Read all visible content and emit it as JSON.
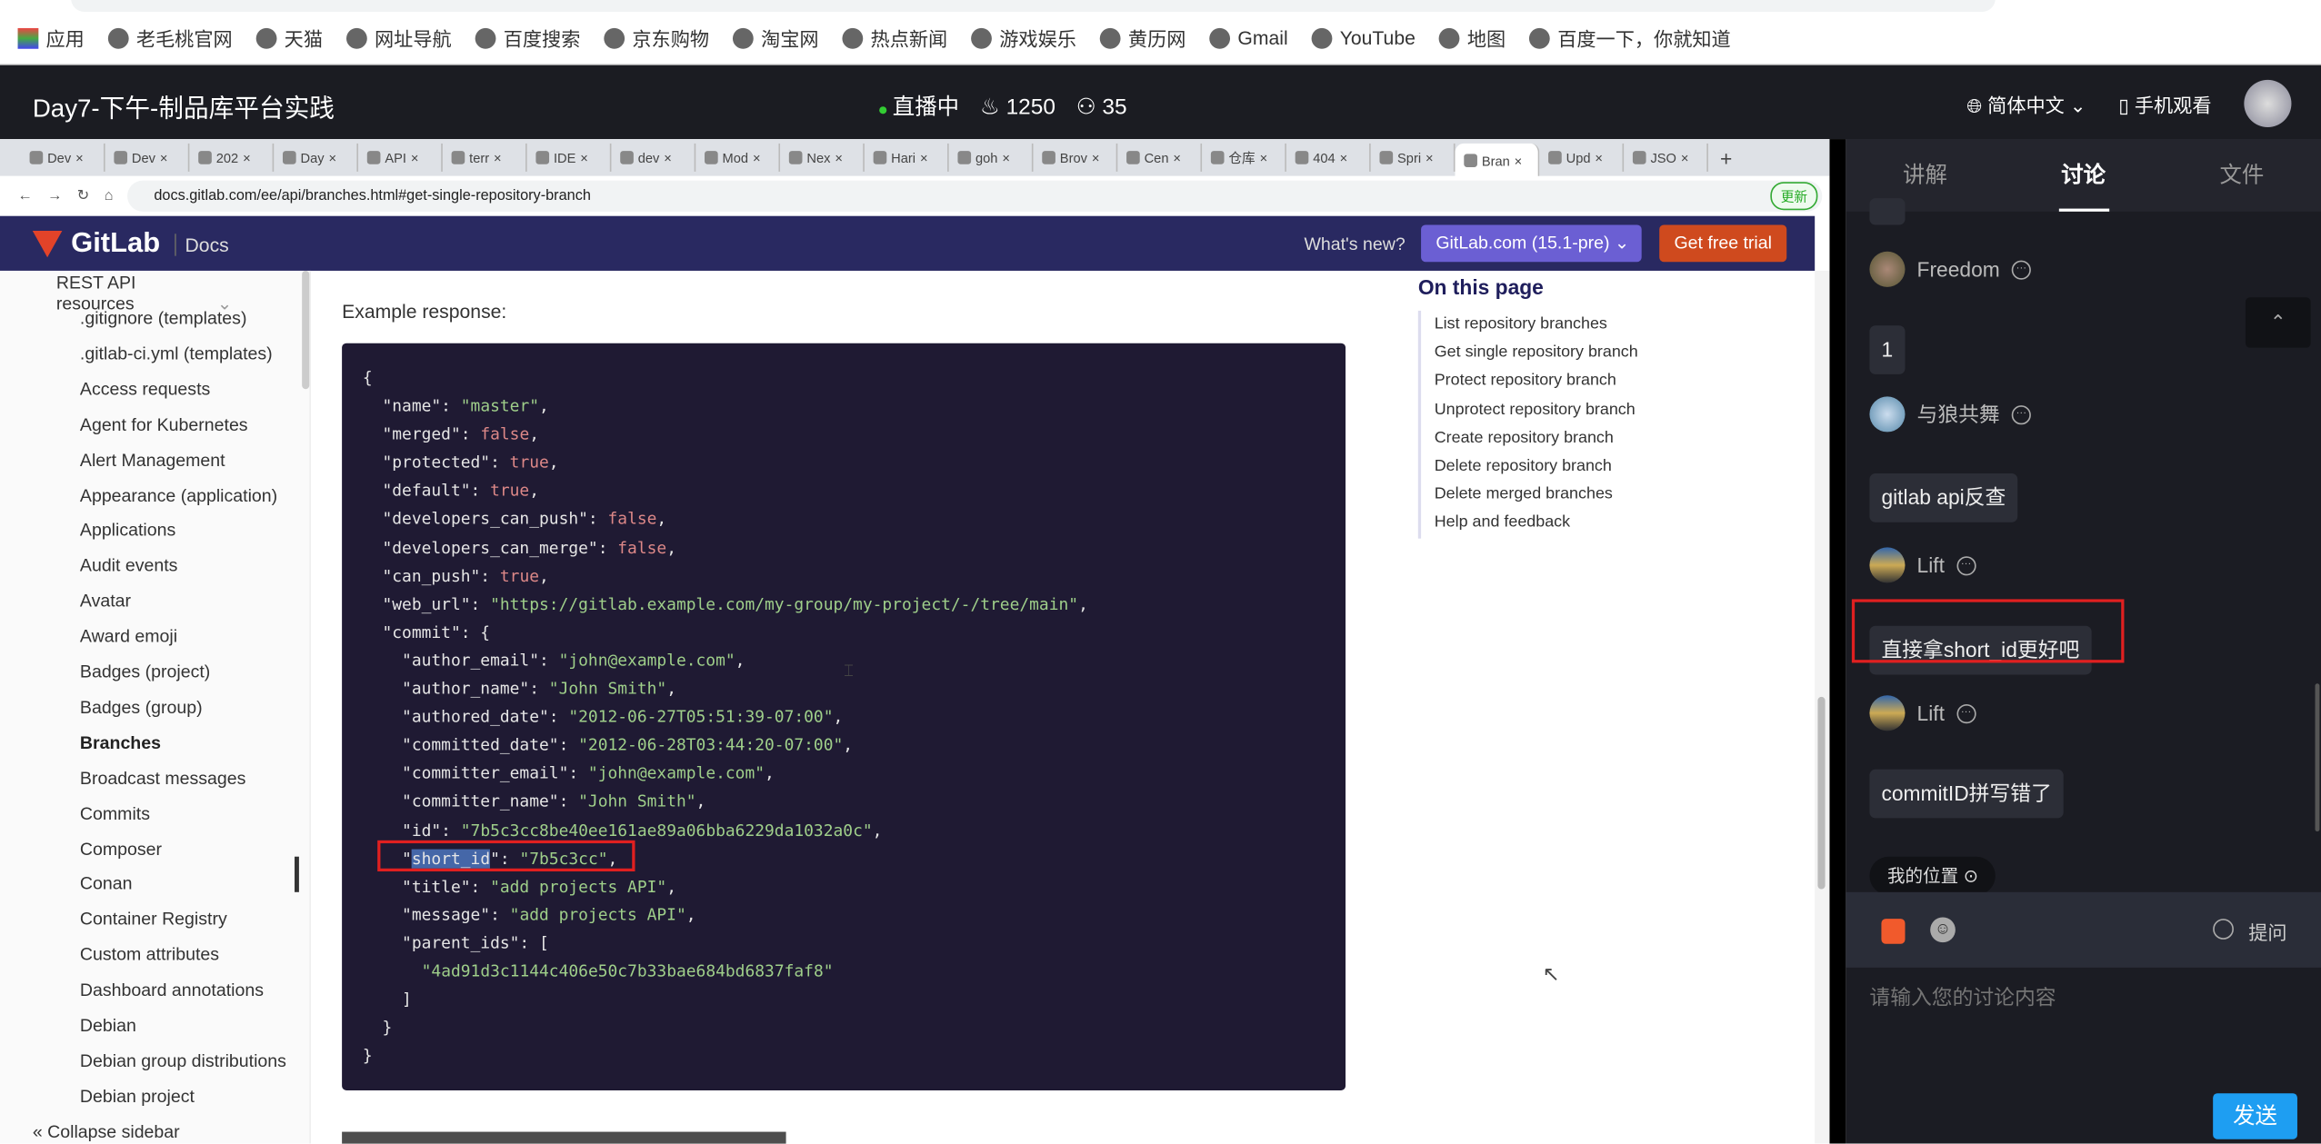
{
  "bookmarks": [
    "应用",
    "老毛桃官网",
    "天猫",
    "网址导航",
    "百度搜索",
    "京东购物",
    "淘宝网",
    "热点新闻",
    "游戏娱乐",
    "黄历网",
    "Gmail",
    "YouTube",
    "地图",
    "百度一下，你就知道"
  ],
  "live": {
    "title": "Day7-下午-制品库平台实践",
    "status": "直播中",
    "hot": "1250",
    "viewers": "35",
    "language": "简体中文",
    "mobile": "手机观看"
  },
  "browser": {
    "tabs": [
      "Dev",
      "Dev",
      "202",
      "Day",
      "API",
      "terr",
      "IDE",
      "dev",
      "Mod",
      "Nex",
      "Hari",
      "goh",
      "Brov",
      "Cen",
      "仓库",
      "404",
      "Spri",
      "Bran",
      "Upd",
      "JSO"
    ],
    "active_tab": 17,
    "url": "docs.gitlab.com/ee/api/branches.html#get-single-repository-branch",
    "update": "更新"
  },
  "gitlab": {
    "logo": "GitLab",
    "docs": "Docs",
    "whats_new": "What's new?",
    "version": "GitLab.com (15.1-pre) ⌄",
    "trial": "Get free trial"
  },
  "sidebar": {
    "section": "REST API resources",
    "items": [
      ".gitignore (templates)",
      ".gitlab-ci.yml (templates)",
      "Access requests",
      "Agent for Kubernetes",
      "Alert Management",
      "Appearance (application)",
      "Applications",
      "Audit events",
      "Avatar",
      "Award emoji",
      "Badges (project)",
      "Badges (group)",
      "Branches",
      "Broadcast messages",
      "Commits",
      "Composer",
      "Conan",
      "Container Registry",
      "Custom attributes",
      "Dashboard annotations",
      "Debian",
      "Debian group distributions",
      "Debian project"
    ],
    "selected": "Branches",
    "collapse": "Collapse sidebar"
  },
  "content": {
    "example_label": "Example response:",
    "code": [
      "{",
      "  \"name\": \"master\",",
      "  \"merged\": false,",
      "  \"protected\": true,",
      "  \"default\": true,",
      "  \"developers_can_push\": false,",
      "  \"developers_can_merge\": false,",
      "  \"can_push\": true,",
      "  \"web_url\": \"https://gitlab.example.com/my-group/my-project/-/tree/main\",",
      "  \"commit\": {",
      "    \"author_email\": \"john@example.com\",",
      "    \"author_name\": \"John Smith\",",
      "    \"authored_date\": \"2012-06-27T05:51:39-07:00\",",
      "    \"committed_date\": \"2012-06-28T03:44:20-07:00\",",
      "    \"committer_email\": \"john@example.com\",",
      "    \"committer_name\": \"John Smith\",",
      "    \"id\": \"7b5c3cc8be40ee161ae89a06bba6229da1032a0c\",",
      "    \"short_id\": \"7b5c3cc\",",
      "    \"title\": \"add projects API\",",
      "    \"message\": \"add projects API\",",
      "    \"parent_ids\": [",
      "      \"4ad91d3c1144c406e50c7b33bae684bd6837faf8\"",
      "    ]",
      "  }",
      "}"
    ]
  },
  "toc": {
    "title": "On this page",
    "items": [
      "List repository branches",
      "Get single repository branch",
      "Protect repository branch",
      "Unprotect repository branch",
      "Create repository branch",
      "Delete repository branch",
      "Delete merged branches",
      "Help and feedback"
    ]
  },
  "panel": {
    "tabs": [
      "讲解",
      "讨论",
      "文件"
    ],
    "active_tab": "讨论",
    "messages": [
      {
        "user": "Freedom"
      },
      {
        "text": "1"
      },
      {
        "user": "与狼共舞"
      },
      {
        "text": "gitlab api反查"
      },
      {
        "user": "Lift"
      },
      {
        "text": "直接拿short_id更好吧"
      },
      {
        "user": "Lift"
      },
      {
        "text": "commitID拼写错了"
      }
    ],
    "my_location": "我的位置",
    "ask": "提问",
    "input_placeholder": "请输入您的讨论内容",
    "send": "发送"
  },
  "colors": {
    "gitlab_header": "#292961",
    "code_bg": "#1f1a33",
    "highlight_box": "#e02020",
    "send": "#1e9ef2"
  }
}
